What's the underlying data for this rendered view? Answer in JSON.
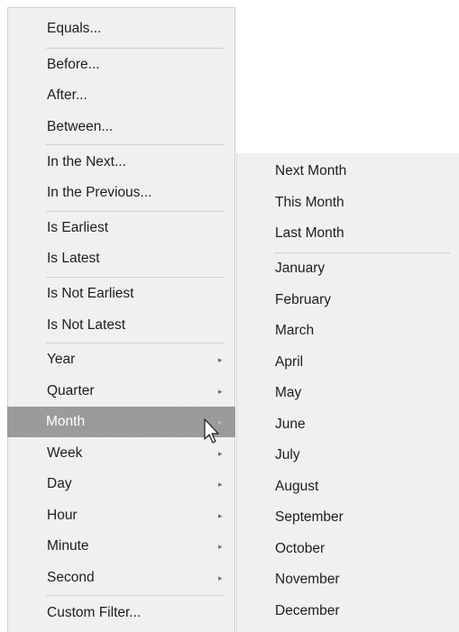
{
  "main_menu": {
    "items": [
      {
        "label": "Equals..."
      },
      {
        "label": "Before..."
      },
      {
        "label": "After..."
      },
      {
        "label": "Between..."
      },
      {
        "label": "In the Next..."
      },
      {
        "label": "In the Previous..."
      },
      {
        "label": "Is Earliest"
      },
      {
        "label": "Is Latest"
      },
      {
        "label": "Is Not Earliest"
      },
      {
        "label": "Is Not Latest"
      },
      {
        "label": "Year",
        "has_submenu": true
      },
      {
        "label": "Quarter",
        "has_submenu": true
      },
      {
        "label": "Month",
        "has_submenu": true,
        "highlighted": true
      },
      {
        "label": "Week",
        "has_submenu": true
      },
      {
        "label": "Day",
        "has_submenu": true
      },
      {
        "label": "Hour",
        "has_submenu": true
      },
      {
        "label": "Minute",
        "has_submenu": true
      },
      {
        "label": "Second",
        "has_submenu": true
      },
      {
        "label": "Custom Filter..."
      }
    ]
  },
  "sub_menu": {
    "items": [
      {
        "label": "Next Month"
      },
      {
        "label": "This Month"
      },
      {
        "label": "Last Month"
      },
      {
        "label": "January"
      },
      {
        "label": "February"
      },
      {
        "label": "March"
      },
      {
        "label": "April"
      },
      {
        "label": "May"
      },
      {
        "label": "June"
      },
      {
        "label": "July"
      },
      {
        "label": "August"
      },
      {
        "label": "September"
      },
      {
        "label": "October"
      },
      {
        "label": "November"
      },
      {
        "label": "December"
      }
    ]
  },
  "icons": {
    "submenu_arrow": "chevron-right-icon",
    "cursor": "mouse-pointer-icon"
  },
  "colors": {
    "menu_background": "#f0f0f0",
    "highlight_background": "#999999",
    "highlight_text": "#ffffff",
    "text": "#1e1e1e",
    "separator": "#cfcfcf"
  }
}
